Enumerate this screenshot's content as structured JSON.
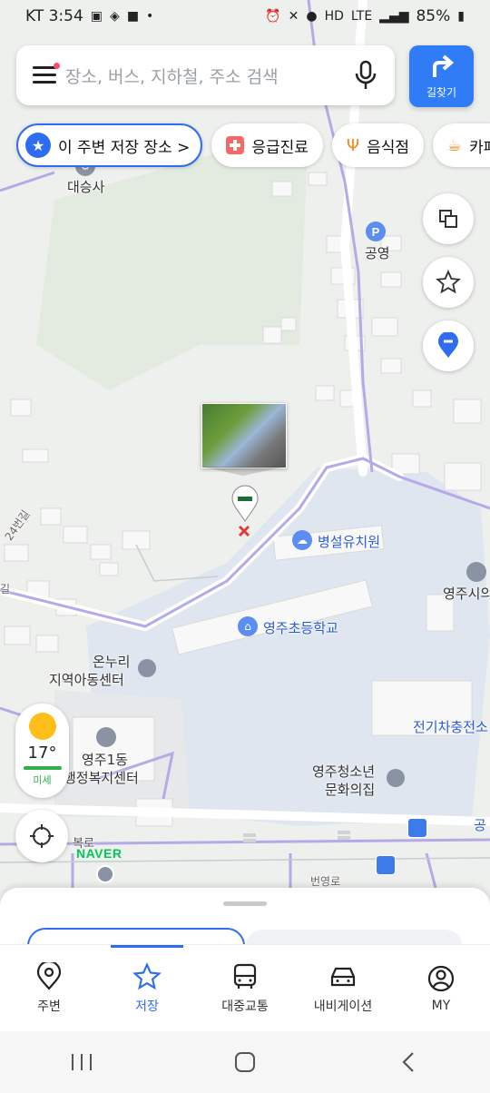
{
  "status_bar": {
    "carrier_time": "KT 3:54",
    "network": "LTE",
    "battery": "85%"
  },
  "search": {
    "placeholder": "장소, 버스, 지하철, 주소 검색"
  },
  "directions_button": {
    "label": "길찾기"
  },
  "chips": [
    {
      "label": "이 주변 저장 장소 >"
    },
    {
      "label": "응급진료"
    },
    {
      "label": "음식점"
    },
    {
      "label": "카페"
    }
  ],
  "map_labels": {
    "temple": "대승사",
    "parking": "공영",
    "kindergarten": "병설유치원",
    "school": "영주초등학교",
    "center_line1": "온누리",
    "center_line2": "지역아동센터",
    "welfare_line1": "영주1동",
    "welfare_line2": "행정복지센터",
    "youth_line1": "영주청소년",
    "youth_line2": "문화의집",
    "city_hall": "영주시의",
    "ev_charger": "전기차충전소",
    "road_1": "24번길",
    "road_2": "복로",
    "road_3": "번영로",
    "road_4": "길",
    "road_5": "공"
  },
  "weather": {
    "temperature": "17°",
    "dust_label": "미세"
  },
  "brand": "NAVER",
  "tabs": [
    {
      "label": "주변",
      "icon": "location-pin-icon"
    },
    {
      "label": "저장",
      "icon": "star-icon"
    },
    {
      "label": "대중교통",
      "icon": "bus-icon"
    },
    {
      "label": "내비게이션",
      "icon": "car-icon"
    },
    {
      "label": "MY",
      "icon": "profile-icon"
    }
  ],
  "colors": {
    "accent": "#2f6df0",
    "directions": "#2f7cf6",
    "school_area": "#dfe6f0",
    "dust_good": "#2db14a"
  }
}
